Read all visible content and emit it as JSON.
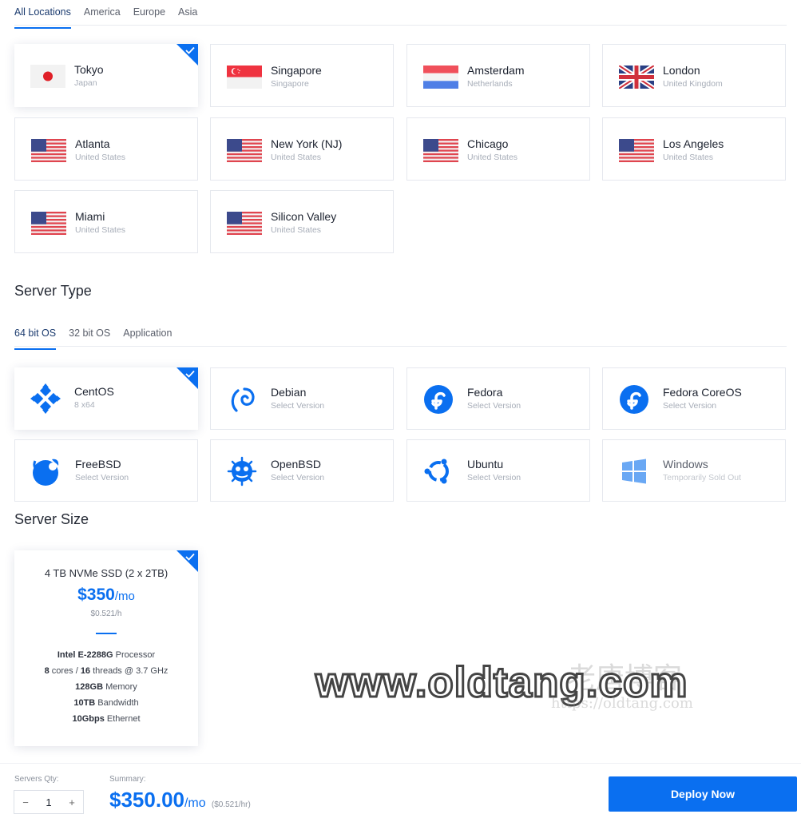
{
  "location_tabs": [
    "All Locations",
    "America",
    "Europe",
    "Asia"
  ],
  "locations": [
    {
      "city": "Tokyo",
      "country": "Japan",
      "flag": "japan-flag"
    },
    {
      "city": "Singapore",
      "country": "Singapore",
      "flag": "singapore-flag"
    },
    {
      "city": "Amsterdam",
      "country": "Netherlands",
      "flag": "netherlands-flag"
    },
    {
      "city": "London",
      "country": "United Kingdom",
      "flag": "uk-flag"
    },
    {
      "city": "Atlanta",
      "country": "United States",
      "flag": "us-flag"
    },
    {
      "city": "New York (NJ)",
      "country": "United States",
      "flag": "us-flag"
    },
    {
      "city": "Chicago",
      "country": "United States",
      "flag": "us-flag"
    },
    {
      "city": "Los Angeles",
      "country": "United States",
      "flag": "us-flag"
    },
    {
      "city": "Miami",
      "country": "United States",
      "flag": "us-flag"
    },
    {
      "city": "Silicon Valley",
      "country": "United States",
      "flag": "us-flag"
    }
  ],
  "server_type": {
    "title": "Server Type",
    "tabs": [
      "64 bit OS",
      "32 bit OS",
      "Application"
    ],
    "os": [
      {
        "name": "CentOS",
        "sub": "8  x64",
        "icon": "centos-icon"
      },
      {
        "name": "Debian",
        "sub": "Select Version",
        "icon": "debian-icon"
      },
      {
        "name": "Fedora",
        "sub": "Select Version",
        "icon": "fedora-icon"
      },
      {
        "name": "Fedora CoreOS",
        "sub": "Select Version",
        "icon": "fedora-coreos-icon"
      },
      {
        "name": "FreeBSD",
        "sub": "Select Version",
        "icon": "freebsd-icon"
      },
      {
        "name": "OpenBSD",
        "sub": "Select Version",
        "icon": "openbsd-icon"
      },
      {
        "name": "Ubuntu",
        "sub": "Select Version",
        "icon": "ubuntu-icon"
      },
      {
        "name": "Windows",
        "sub": "Temporarily Sold Out",
        "icon": "windows-icon"
      }
    ]
  },
  "server_size": {
    "title": "Server Size",
    "plan": {
      "storage": "4 TB NVMe SSD (2 x 2TB)",
      "price": "$350",
      "per": "/mo",
      "hourly": "$0.521/h",
      "processor_bold": "Intel E-2288G",
      "processor_rest": " Processor",
      "cores_bold": "8",
      "cores_text": " cores / ",
      "threads_bold": "16",
      "threads_text": " threads @ 3.7 GHz",
      "memory_bold": "128GB",
      "memory_text": " Memory",
      "bandwidth_bold": "10TB",
      "bandwidth_text": " Bandwidth",
      "ethernet_bold": "10Gbps",
      "ethernet_text": " Ethernet"
    }
  },
  "footer": {
    "qty_label": "Servers Qty:",
    "qty_minus": "−",
    "qty_value": "1",
    "qty_plus": "+",
    "summary_label": "Summary:",
    "total": "$350.00",
    "total_per": "/mo",
    "total_hourly": "($0.521/hr)",
    "deploy_label": "Deploy Now"
  },
  "watermark": {
    "text": "www.oldtang.com",
    "cn": "老唐博客",
    "url": "https://oldtang.com"
  },
  "colors": {
    "accent": "#0a6ff0"
  }
}
